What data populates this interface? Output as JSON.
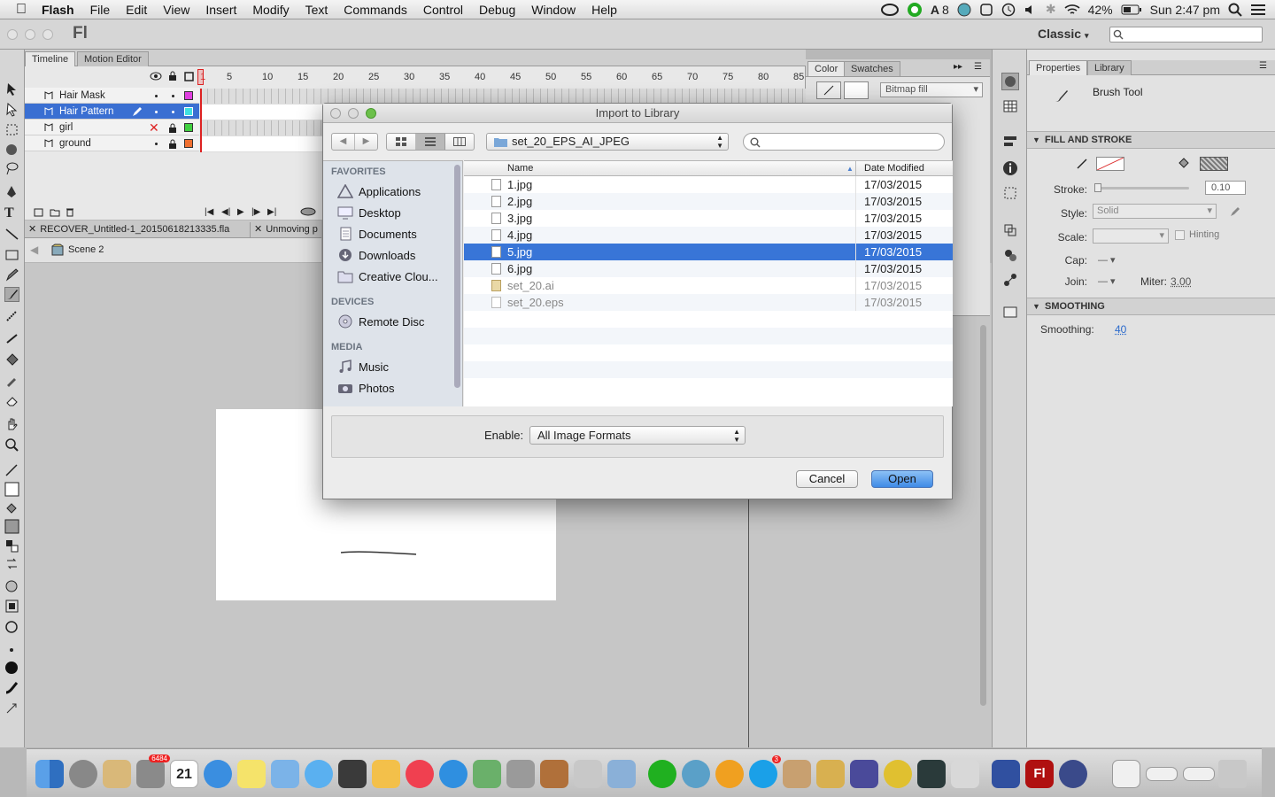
{
  "menubar": {
    "app_name": "Flash",
    "items": [
      "File",
      "Edit",
      "View",
      "Insert",
      "Modify",
      "Text",
      "Commands",
      "Control",
      "Debug",
      "Window",
      "Help"
    ],
    "status": {
      "adobe_badge": "8",
      "battery": "42%",
      "clock": "Sun 2:47 pm"
    }
  },
  "appbar": {
    "logo": "Fl",
    "workspace": "Classic"
  },
  "timeline": {
    "tabs": [
      "Timeline",
      "Motion Editor"
    ],
    "frame_ticks": [
      "1",
      "5",
      "10",
      "15",
      "20",
      "25",
      "30",
      "35",
      "40",
      "45",
      "50",
      "55",
      "60",
      "65",
      "70",
      "75",
      "80",
      "85"
    ],
    "layers": [
      {
        "name": "Hair Mask",
        "color": "#e040e0",
        "selected": false
      },
      {
        "name": "Hair Pattern",
        "color": "#40e0e0",
        "selected": true
      },
      {
        "name": "girl",
        "color": "#40d040",
        "selected": false
      },
      {
        "name": "ground",
        "color": "#f07030",
        "selected": false
      }
    ]
  },
  "doc_tabs": [
    "RECOVER_Untitled-1_20150618213335.fla",
    "Unmoving p"
  ],
  "scene": "Scene 2",
  "color_panel": {
    "tabs": [
      "Color",
      "Swatches"
    ],
    "fill_type": "Bitmap fill"
  },
  "properties": {
    "tabs": [
      "Properties",
      "Library"
    ],
    "tool": "Brush Tool",
    "fill_stroke_header": "FILL AND STROKE",
    "stroke_label": "Stroke:",
    "stroke_value": "0.10",
    "style_label": "Style:",
    "style_value": "Solid",
    "scale_label": "Scale:",
    "hinting_label": "Hinting",
    "cap_label": "Cap:",
    "join_label": "Join:",
    "miter_label": "Miter:",
    "miter_value": "3.00",
    "smoothing_header": "SMOOTHING",
    "smoothing_label": "Smoothing:",
    "smoothing_value": "40"
  },
  "dialog": {
    "title": "Import to Library",
    "folder": "set_20_EPS_AI_JPEG",
    "search_placeholder": "",
    "sidebar": {
      "favorites_header": "FAVORITES",
      "favorites": [
        "Applications",
        "Desktop",
        "Documents",
        "Downloads",
        "Creative Clou..."
      ],
      "devices_header": "DEVICES",
      "devices": [
        "Remote Disc"
      ],
      "media_header": "MEDIA",
      "media": [
        "Music",
        "Photos"
      ]
    },
    "columns": {
      "name": "Name",
      "date": "Date Modified"
    },
    "files": [
      {
        "name": "1.jpg",
        "date": "17/03/2015"
      },
      {
        "name": "2.jpg",
        "date": "17/03/2015"
      },
      {
        "name": "3.jpg",
        "date": "17/03/2015"
      },
      {
        "name": "4.jpg",
        "date": "17/03/2015"
      },
      {
        "name": "5.jpg",
        "date": "17/03/2015"
      },
      {
        "name": "6.jpg",
        "date": "17/03/2015"
      },
      {
        "name": "set_20.ai",
        "date": "17/03/2015"
      },
      {
        "name": "set_20.eps",
        "date": "17/03/2015"
      }
    ],
    "selected_index": 4,
    "enable_label": "Enable:",
    "enable_value": "All Image Formats",
    "cancel_label": "Cancel",
    "open_label": "Open"
  },
  "dock": {
    "calendar_day": "21",
    "mail_badge": "6484",
    "skype_badge": "3"
  },
  "colors": {
    "selection": "#3875d7",
    "layer_selected": "#3a6fd2",
    "playhead": "#e03030"
  }
}
